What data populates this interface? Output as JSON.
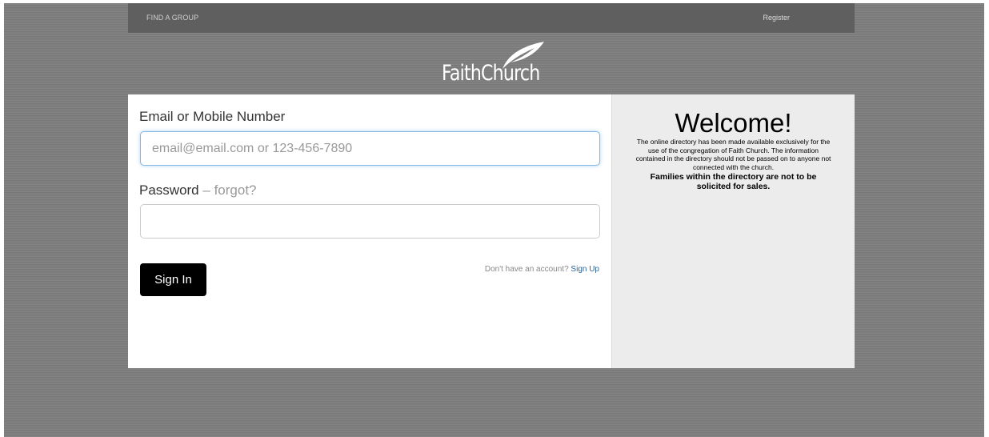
{
  "nav": {
    "find_group": "FIND A GROUP",
    "register": "Register"
  },
  "logo": {
    "text": "FaithChurch",
    "icon": "leaf-icon"
  },
  "form": {
    "email_label": "Email or Mobile Number",
    "email_placeholder": "email@email.com or 123-456-7890",
    "email_value": "",
    "password_label": "Password",
    "password_separator": "–",
    "forgot_link": "forgot?",
    "password_value": "",
    "signin_button": "Sign In",
    "signup_prompt": "Don't have an account?",
    "signup_link": "Sign Up"
  },
  "welcome": {
    "title": "Welcome!",
    "body": "The online directory has been made available exclusively for the use of the congregation of Faith Church. The information contained in the directory should not be passed on to anyone not connected with the church.",
    "bold_notice": "Families within the directory are not to be solicited for sales."
  },
  "colors": {
    "background": "#7d7d7d",
    "nav_bar": "#5f5f5f",
    "welcome_panel": "#ececec",
    "button": "#000000",
    "link": "#2a6496"
  }
}
